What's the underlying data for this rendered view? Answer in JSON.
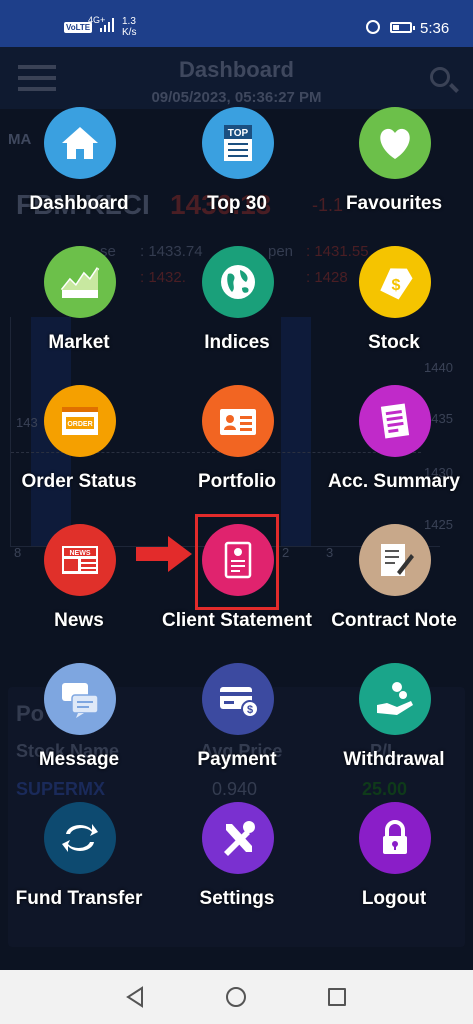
{
  "status_bar": {
    "network_type": "VoLTE",
    "signal_label": "4G+",
    "speed_value": "1.3",
    "speed_unit": "K/s",
    "time": "5:36"
  },
  "background": {
    "title": "Dashboard",
    "datetime": "09/05/2023, 05:36:27 PM",
    "market_label": "MA",
    "index_name": "FBM KLCI",
    "index_value": "1430.13",
    "index_change": "-1.1",
    "stat_row1_a": "se",
    "stat_row1_b": ": 1433.74",
    "stat_row1_c": "pen",
    "stat_row1_d": ": 1431.55",
    "stat_row2_b": ": 1432.",
    "stat_row2_d": ": 1428",
    "y_ticks": [
      "1440",
      "1435",
      "1430",
      "1425"
    ],
    "left_tick": "143",
    "x_ticks": [
      "8",
      "2",
      "3"
    ],
    "panel_title": "Po",
    "col_stock": "Stock Name",
    "col_avg": "Avg Price",
    "col_pl": "P/L",
    "row_stock": "SUPERMX",
    "row_avg": "0.940",
    "row_pl": "25.00"
  },
  "menu": [
    {
      "label": "Dashboard",
      "icon": "home-icon",
      "color": "#3aa0e0"
    },
    {
      "label": "Top 30",
      "icon": "top-list-icon",
      "color": "#3aa0e0"
    },
    {
      "label": "Favourites",
      "icon": "heart-icon",
      "color": "#6cc04a"
    },
    {
      "label": "Market",
      "icon": "market-chart-icon",
      "color": "#6cc04a"
    },
    {
      "label": "Indices",
      "icon": "globe-icon",
      "color": "#1aa07a"
    },
    {
      "label": "Stock",
      "icon": "price-tag-icon",
      "color": "#f5c400"
    },
    {
      "label": "Order Status",
      "icon": "order-icon",
      "color": "#f5a000"
    },
    {
      "label": "Portfolio",
      "icon": "id-card-icon",
      "color": "#f26522"
    },
    {
      "label": "Acc. Summary",
      "icon": "summary-doc-icon",
      "color": "#c02ac9"
    },
    {
      "label": "News",
      "icon": "newspaper-icon",
      "color": "#e0302a"
    },
    {
      "label": "Client Statement",
      "icon": "client-statement-icon",
      "color": "#e0236e"
    },
    {
      "label": "Contract Note",
      "icon": "contract-note-icon",
      "color": "#c8a88a"
    },
    {
      "label": "Message",
      "icon": "message-icon",
      "color": "#7ea6e0"
    },
    {
      "label": "Payment",
      "icon": "payment-card-icon",
      "color": "#3c4aa0"
    },
    {
      "label": "Withdrawal",
      "icon": "withdrawal-hand-icon",
      "color": "#1aa58a"
    },
    {
      "label": "Fund Transfer",
      "icon": "transfer-icon",
      "color": "#0d4a70"
    },
    {
      "label": "Settings",
      "icon": "tools-icon",
      "color": "#7a30d0"
    },
    {
      "label": "Logout",
      "icon": "lock-icon",
      "color": "#8a1ec8"
    }
  ],
  "annotation_color": "#e32b2b"
}
